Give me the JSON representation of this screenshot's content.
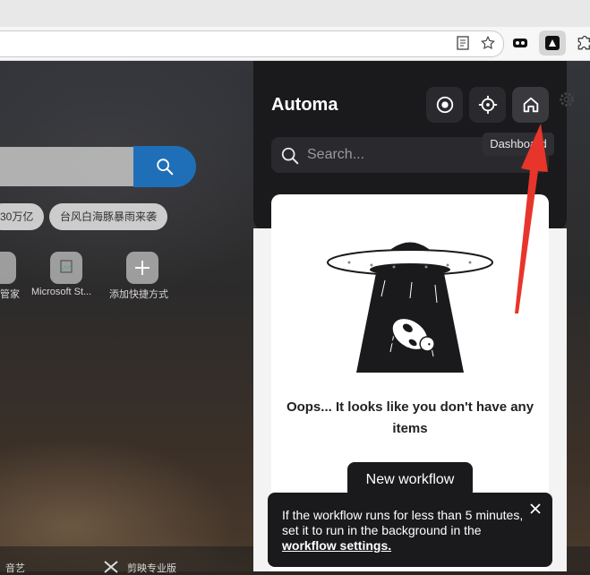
{
  "browser": {
    "reader_icon": "reader-mode-icon",
    "bookmark_icon": "star-icon",
    "extensions": [
      "extension-icon",
      "automa-extension-icon",
      "puzzle-icon"
    ]
  },
  "newtab": {
    "chips": [
      "30万亿",
      "台风白海豚暴雨来袭"
    ],
    "shortcuts": [
      "管家",
      "Microsoft St...",
      "添加快捷方式"
    ],
    "bottom_items": [
      "音艺",
      "剪映专业版"
    ]
  },
  "popup": {
    "title": "Automa",
    "header_buttons": [
      "record-icon",
      "target-icon",
      "home-icon"
    ],
    "tooltip": "Dashboard",
    "search_placeholder": "Search...",
    "empty_message": "Oops... It looks like you don't have any items",
    "new_workflow_label": "New workflow"
  },
  "toast": {
    "text_before": "If the workflow runs for less than 5 minutes, set it to run in the background in the ",
    "link_text": "workflow settings.",
    "close_icon": "close-icon"
  },
  "colors": {
    "popup_dark": "#1a1a1d",
    "search_blue": "#1f6fb8",
    "arrow_red": "#e8352b"
  }
}
